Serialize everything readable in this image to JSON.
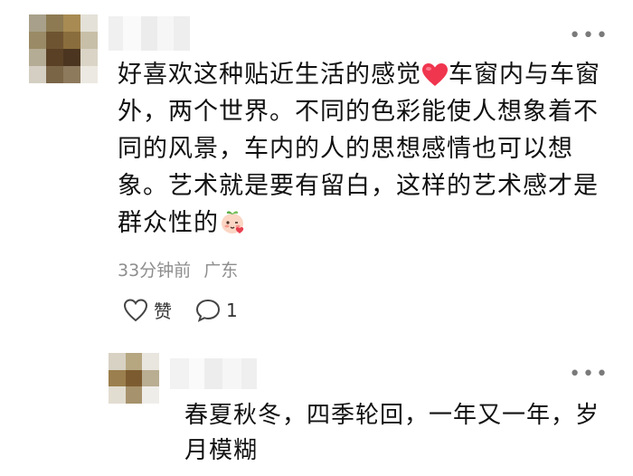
{
  "comment": {
    "text_part1": "好喜欢这种贴近生活的感觉",
    "text_part2": "车窗内与车窗外，两个世界。不同的色彩能使人想象着不同的风景，车内的人的思想感情也可以想象。艺术就是要有留白，这样的艺术感才是群众性的",
    "time": "33分钟前",
    "location": "广东",
    "like_label": "赞",
    "reply_count": "1",
    "heart_emoji": "heart-emoji",
    "sticker_emoji": "peach-face-emoji"
  },
  "reply": {
    "text": "春夏秋冬，四季轮回，一年又一年，岁月模糊"
  },
  "icons": {
    "more": "more-icon",
    "like": "heart-outline-icon",
    "reply": "comment-bubble-icon"
  },
  "colors": {
    "heart": "#f0364f",
    "meta_text": "#8e8e8e",
    "body_text": "#111111"
  }
}
